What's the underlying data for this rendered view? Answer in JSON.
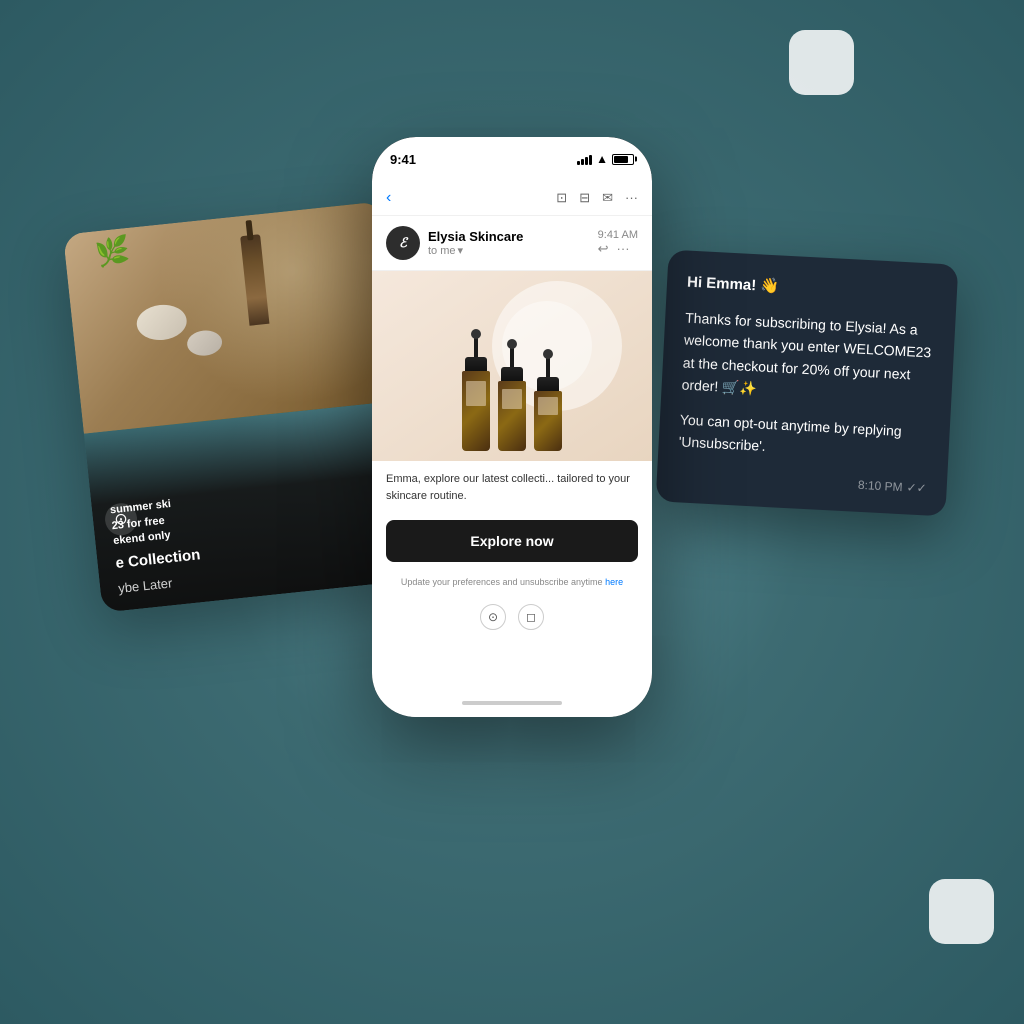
{
  "scene": {
    "background_color": "#4a7a80"
  },
  "left_card": {
    "subtitle_line1": "summer ski",
    "subtitle_line2": "23 for free",
    "subtitle_line3": "ekend only",
    "title": "e Collection",
    "action": "ybe Later"
  },
  "phone": {
    "time": "9:41",
    "email": {
      "sender_name": "Elysia Skincare",
      "sender_time": "9:41 AM",
      "sender_to": "to me",
      "body_text": "Emma, explore our latest collecti... tailored to your skincare routine.",
      "cta_button": "Explore now",
      "footer_text": "Update your preferences and unsubscribe anytime",
      "footer_link_text": "here"
    }
  },
  "right_card": {
    "greeting": "Hi Emma! 👋",
    "body": "Thanks for subscribing to Elysia! As a welcome thank you enter WELCOME23 at the checkout for 20% off your next order! 🛒✨",
    "opt_out": "You can opt-out anytime by replying 'Unsubscribe'.",
    "time": "8:10 PM"
  },
  "deco": {
    "top_square": "decorative white rounded square",
    "bottom_square": "decorative white rounded square"
  }
}
